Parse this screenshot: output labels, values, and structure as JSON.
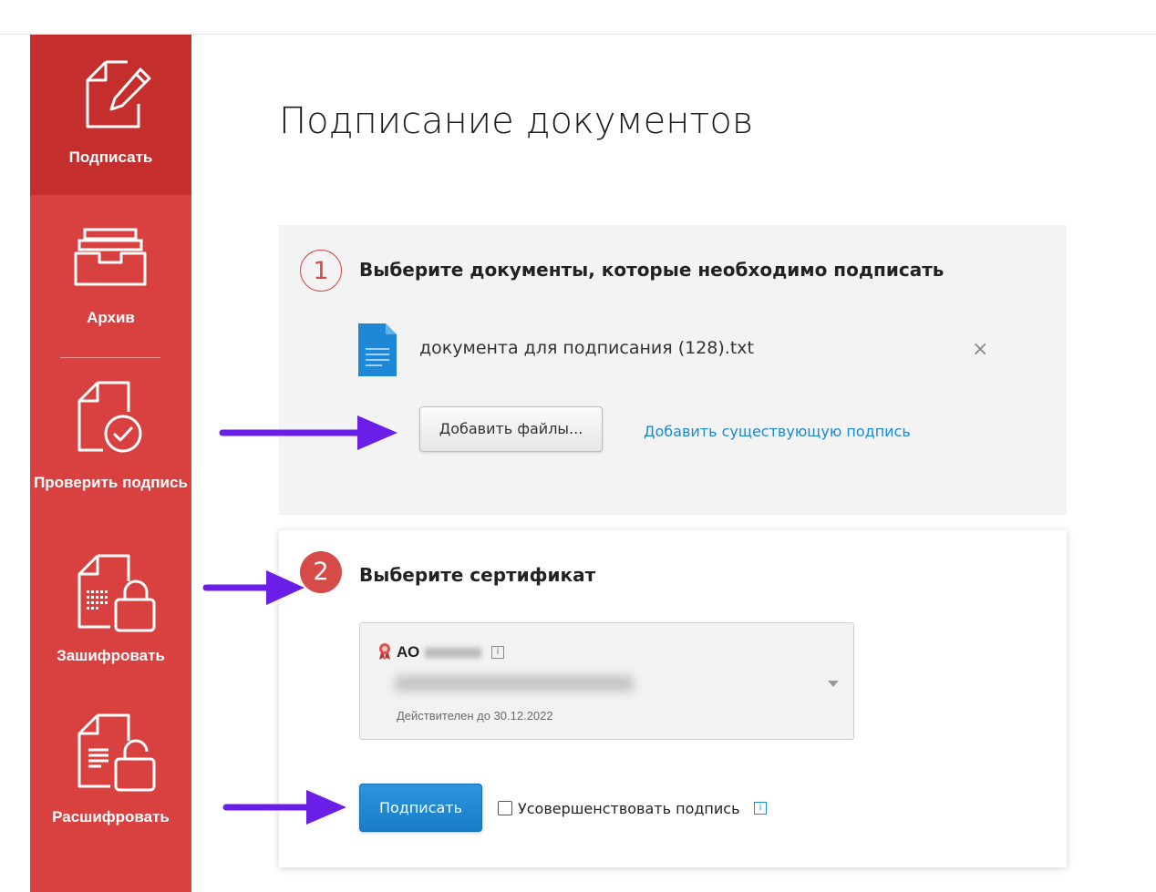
{
  "sidebar": {
    "items": [
      {
        "label": "Подписать",
        "icon": "sign-document-icon",
        "active": true
      },
      {
        "label": "Архив",
        "icon": "archive-tray-icon"
      },
      {
        "label": "Проверить подпись",
        "icon": "verify-signature-icon"
      },
      {
        "label": "Зашифровать",
        "icon": "encrypt-lock-icon"
      },
      {
        "label": "Расшифровать",
        "icon": "decrypt-unlock-icon"
      }
    ]
  },
  "page": {
    "title": "Подписание документов"
  },
  "step1": {
    "number": "1",
    "title": "Выберите документы, которые необходимо подписать",
    "file": {
      "name": "документа для подписания (128).txt",
      "remove": "×"
    },
    "add_files_button": "Добавить файлы...",
    "add_existing_link": "Добавить существующую подпись"
  },
  "step2": {
    "number": "2",
    "title": "Выберите сертификат",
    "certificate": {
      "org": "АО",
      "info": "i",
      "valid_until": "Действителен до 30.12.2022"
    },
    "sign_button": "Подписать",
    "enhance_label": "Усовершенствовать подпись",
    "enhance_checked": false,
    "info": "i"
  },
  "colors": {
    "sidebar": "#d8413f",
    "sidebar_active": "#c42f2e",
    "accent_red": "#d64b47",
    "primary_blue": "#1a7cc8",
    "link_blue": "#1b8ad3",
    "annotation_arrow": "#6a1ee8"
  }
}
